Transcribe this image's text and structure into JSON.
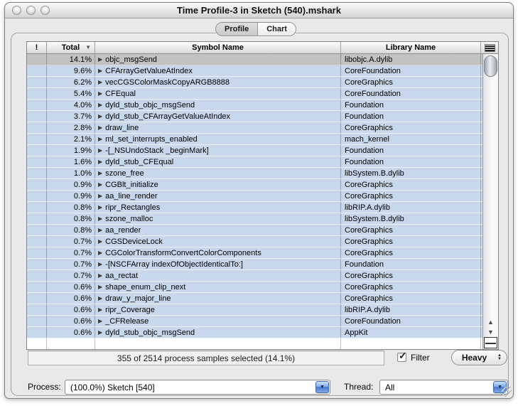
{
  "window": {
    "title": "Time Profile-3 in Sketch (540).mshark"
  },
  "icons": {
    "disclosure": "▶",
    "sort_desc": "▼",
    "scroll_up": "▲",
    "scroll_down": "▼",
    "stepper_up": "▲",
    "stepper_down": "▼",
    "combo_arrow": "▼",
    "check": "✓"
  },
  "tabs": {
    "profile": "Profile",
    "chart": "Chart",
    "selected": "Profile"
  },
  "table": {
    "columns": {
      "flag": "!",
      "total": "Total",
      "symbol": "Symbol Name",
      "library": "Library Name"
    },
    "sorted_by": "Total",
    "sort_direction": "descending",
    "rows": [
      {
        "total": "14.1%",
        "symbol": "objc_msgSend",
        "library": "libobjc.A.dylib",
        "selected": true
      },
      {
        "total": "9.6%",
        "symbol": "CFArrayGetValueAtIndex",
        "library": "CoreFoundation",
        "selected": false
      },
      {
        "total": "6.2%",
        "symbol": "vecCGSColorMaskCopyARGB8888",
        "library": "CoreGraphics",
        "selected": false
      },
      {
        "total": "5.4%",
        "symbol": "CFEqual",
        "library": "CoreFoundation",
        "selected": false
      },
      {
        "total": "4.0%",
        "symbol": "dyld_stub_objc_msgSend",
        "library": "Foundation",
        "selected": false
      },
      {
        "total": "3.7%",
        "symbol": "dyld_stub_CFArrayGetValueAtIndex",
        "library": "Foundation",
        "selected": false
      },
      {
        "total": "2.8%",
        "symbol": "draw_line",
        "library": "CoreGraphics",
        "selected": false
      },
      {
        "total": "2.1%",
        "symbol": "ml_set_interrupts_enabled",
        "library": "mach_kernel",
        "selected": false
      },
      {
        "total": "1.9%",
        "symbol": "-[_NSUndoStack _beginMark]",
        "library": "Foundation",
        "selected": false
      },
      {
        "total": "1.6%",
        "symbol": "dyld_stub_CFEqual",
        "library": "Foundation",
        "selected": false
      },
      {
        "total": "1.0%",
        "symbol": "szone_free",
        "library": "libSystem.B.dylib",
        "selected": false
      },
      {
        "total": "0.9%",
        "symbol": "CGBlt_initialize",
        "library": "CoreGraphics",
        "selected": false
      },
      {
        "total": "0.9%",
        "symbol": "aa_line_render",
        "library": "CoreGraphics",
        "selected": false
      },
      {
        "total": "0.8%",
        "symbol": "ripr_Rectangles",
        "library": "libRIP.A.dylib",
        "selected": false
      },
      {
        "total": "0.8%",
        "symbol": "szone_malloc",
        "library": "libSystem.B.dylib",
        "selected": false
      },
      {
        "total": "0.8%",
        "symbol": "aa_render",
        "library": "CoreGraphics",
        "selected": false
      },
      {
        "total": "0.7%",
        "symbol": "CGSDeviceLock",
        "library": "CoreGraphics",
        "selected": false
      },
      {
        "total": "0.7%",
        "symbol": "CGColorTransformConvertColorComponents",
        "library": "CoreGraphics",
        "selected": false
      },
      {
        "total": "0.7%",
        "symbol": "-[NSCFArray indexOfObjectIdenticalTo:]",
        "library": "Foundation",
        "selected": false
      },
      {
        "total": "0.7%",
        "symbol": "aa_rectat",
        "library": "CoreGraphics",
        "selected": false
      },
      {
        "total": "0.6%",
        "symbol": "shape_enum_clip_next",
        "library": "CoreGraphics",
        "selected": false
      },
      {
        "total": "0.6%",
        "symbol": "draw_y_major_line",
        "library": "CoreGraphics",
        "selected": false
      },
      {
        "total": "0.6%",
        "symbol": "ripr_Coverage",
        "library": "libRIP.A.dylib",
        "selected": false
      },
      {
        "total": "0.6%",
        "symbol": "_CFRelease",
        "library": "CoreFoundation",
        "selected": false
      },
      {
        "total": "0.6%",
        "symbol": "dyld_stub_objc_msgSend",
        "library": "AppKit",
        "selected": false
      }
    ]
  },
  "status": {
    "samples_text": "355 of 2514 process samples selected (14.1%)",
    "filter_label": "Filter",
    "filter_checked": true,
    "view_mode": "Heavy"
  },
  "footer": {
    "process_label": "Process:",
    "process_value": "(100.0%) Sketch [540]",
    "thread_label": "Thread:",
    "thread_value": "All"
  },
  "colors": {
    "row_blue": "#c8d8ec",
    "selected_row_gray": "#c2c2c2",
    "window_bg": "#e9e9e9",
    "combo_button_blue": "#4878cf"
  }
}
